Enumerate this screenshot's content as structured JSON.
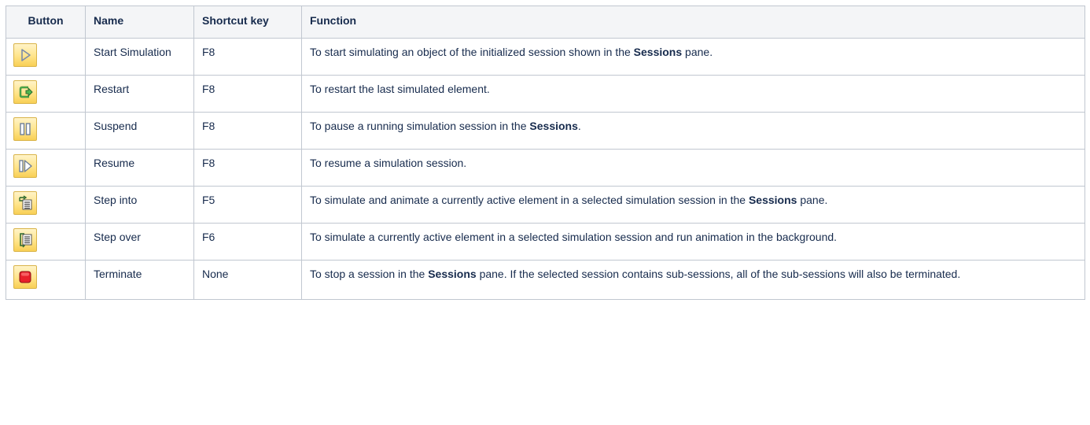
{
  "table": {
    "headers": {
      "button": "Button",
      "name": "Name",
      "shortcut": "Shortcut key",
      "function": "Function"
    },
    "rows": [
      {
        "icon": "start-simulation-icon",
        "name": "Start Simulation",
        "shortcut": "F8",
        "function": {
          "pre": "To start simulating an object of the initialized session shown in the ",
          "bold": "Sessions",
          "post": " pane."
        }
      },
      {
        "icon": "restart-icon",
        "name": "Restart",
        "shortcut": "F8",
        "function": {
          "pre": "To restart the last simulated element.",
          "bold": "",
          "post": ""
        }
      },
      {
        "icon": "suspend-icon",
        "name": "Suspend",
        "shortcut": "F8",
        "function": {
          "pre": "To pause a running simulation session in the ",
          "bold": "Sessions",
          "post": "."
        }
      },
      {
        "icon": "resume-icon",
        "name": "Resume",
        "shortcut": "F8",
        "function": {
          "pre": "To resume a simulation session.",
          "bold": "",
          "post": ""
        }
      },
      {
        "icon": "step-into-icon",
        "name": "Step into",
        "shortcut": "F5",
        "function": {
          "pre": "To simulate and animate a currently active element in a selected simulation session in the ",
          "bold": "Sessions",
          "post": " pane."
        }
      },
      {
        "icon": "step-over-icon",
        "name": "Step over",
        "shortcut": "F6",
        "function": {
          "pre": "To simulate a currently active element in a selected simulation session and run animation in the background.",
          "bold": "",
          "post": ""
        }
      },
      {
        "icon": "terminate-icon",
        "name": "Terminate",
        "shortcut": "None",
        "function": {
          "pre": "To stop a session in the ",
          "bold": "Sessions",
          "post": " pane. If the selected session contains sub-sessions, all of the sub-sessions will also be terminated."
        }
      }
    ]
  }
}
